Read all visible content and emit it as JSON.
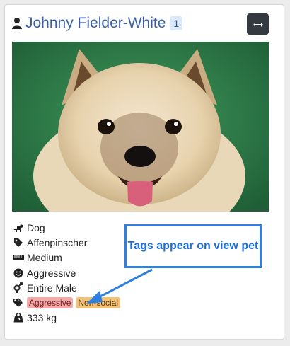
{
  "owner": {
    "name": "Johnny Fielder-White",
    "count": "1"
  },
  "icons": {
    "owner": "user-icon",
    "swap": "swap-arrows-icon",
    "species": "dog-icon",
    "breed": "tag-icon",
    "size": "ruler-icon",
    "temperament": "smiley-icon",
    "sex": "gender-icon",
    "tags": "tags-icon",
    "weight": "weight-icon"
  },
  "pet": {
    "species": "Dog",
    "breed": "Affenpinscher",
    "size": "Medium",
    "temperament": "Aggressive",
    "sex": "Entire Male",
    "weight": "333 kg",
    "tags": [
      "Aggressive",
      "Non-social"
    ]
  },
  "annotation": {
    "text": "Tags appear on view pet"
  },
  "colors": {
    "owner_name": "#3a5fa8",
    "swap_button": "#343a40",
    "tag_aggressive": "#f1a9a9",
    "tag_nonsocial": "#f0c27b",
    "callout_accent": "#2f7fe0"
  }
}
